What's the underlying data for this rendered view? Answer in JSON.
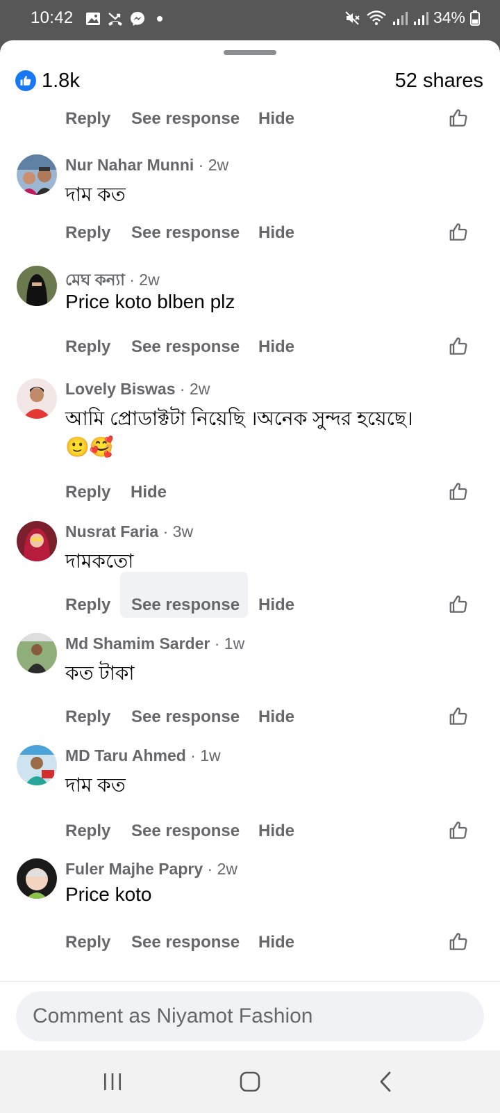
{
  "status_bar": {
    "time": "10:42",
    "battery": "34%",
    "left_icons": [
      "gallery-icon",
      "missed-call-icon",
      "messenger-icon",
      "dot-icon"
    ],
    "right_icons": [
      "mute-icon",
      "wifi-icon",
      "signal-icon",
      "signal-icon",
      "battery-icon"
    ]
  },
  "post_stats": {
    "likes": "1.8k",
    "shares": "52 shares"
  },
  "action_labels": {
    "reply": "Reply",
    "see_response": "See response",
    "hide": "Hide"
  },
  "comments": [
    {
      "name": "Nur Nahar Munni",
      "time": " · 2w",
      "text": "দাম কত",
      "has_see_response": true
    },
    {
      "name": "মেঘ  কন্যা",
      "time": " · 2w",
      "text": "Price koto blben plz",
      "has_see_response": true
    },
    {
      "name": "Lovely Biswas",
      "time": " · 2w",
      "text": "আমি প্রোডাক্টটা  নিয়েছি ।অনেক সুন্দর হয়েছে।",
      "text2": "🙂🥰",
      "has_see_response": false
    },
    {
      "name": "Nusrat Faria",
      "time": " · 3w",
      "text": "দামকতো",
      "has_see_response": true,
      "highlighted": true
    },
    {
      "name": "Md Shamim Sarder",
      "time": " · 1w",
      "text": "কত টাকা",
      "has_see_response": true
    },
    {
      "name": "MD Taru Ahmed",
      "time": " · 1w",
      "text": "দাম কত",
      "has_see_response": true
    },
    {
      "name": "Fuler Majhe Papry",
      "time": " · 2w",
      "text": "Price koto",
      "has_see_response": true
    }
  ],
  "comment_input": {
    "placeholder": "Comment as Niyamot Fashion"
  },
  "colors": {
    "accent": "#1877f2",
    "secondary_text": "#65676b",
    "status_bar_bg": "#575757"
  }
}
